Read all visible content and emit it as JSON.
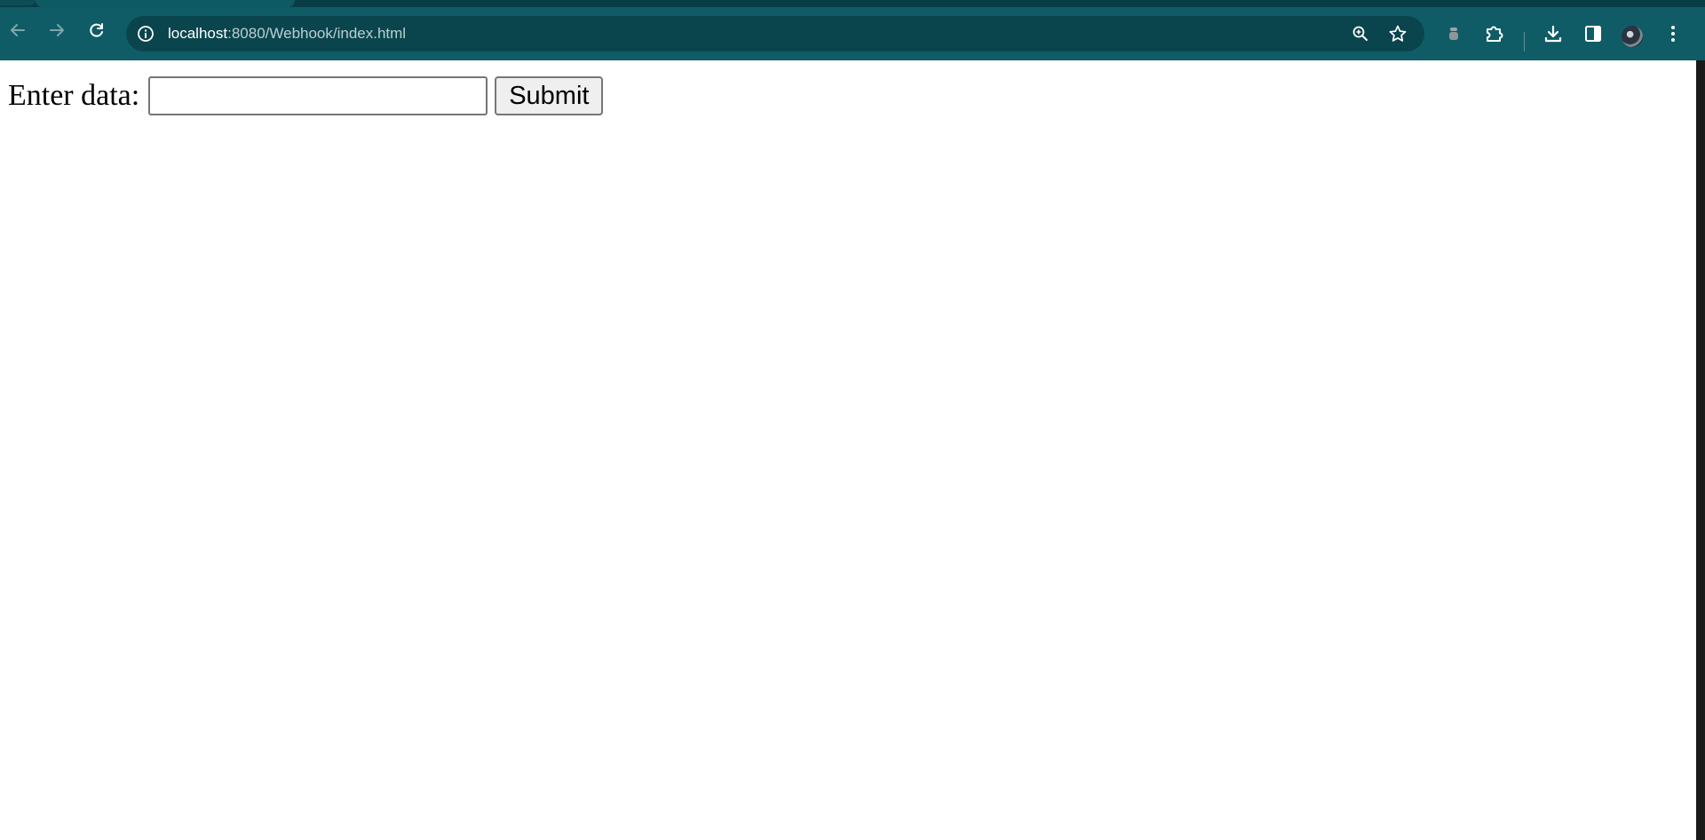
{
  "browser": {
    "url_host": "localhost",
    "url_path": ":8080/Webhook/index.html",
    "icons": {
      "back": "back-arrow-icon",
      "forward": "forward-arrow-icon",
      "reload": "reload-icon",
      "site_info": "site-info-icon",
      "zoom": "zoom-icon",
      "bookmark": "bookmark-star-icon",
      "extension_pinned": "extension-icon",
      "extensions": "puzzle-icon",
      "downloads": "download-icon",
      "side_panel": "side-panel-icon",
      "profile": "avatar",
      "menu": "more-vert-icon"
    },
    "colors": {
      "toolbar": "#0f5c66",
      "tabstrip": "#083e47",
      "omnibox": "#0a454e"
    }
  },
  "page": {
    "form": {
      "label": "Enter data:",
      "input_value": "",
      "submit_label": "Submit"
    }
  }
}
